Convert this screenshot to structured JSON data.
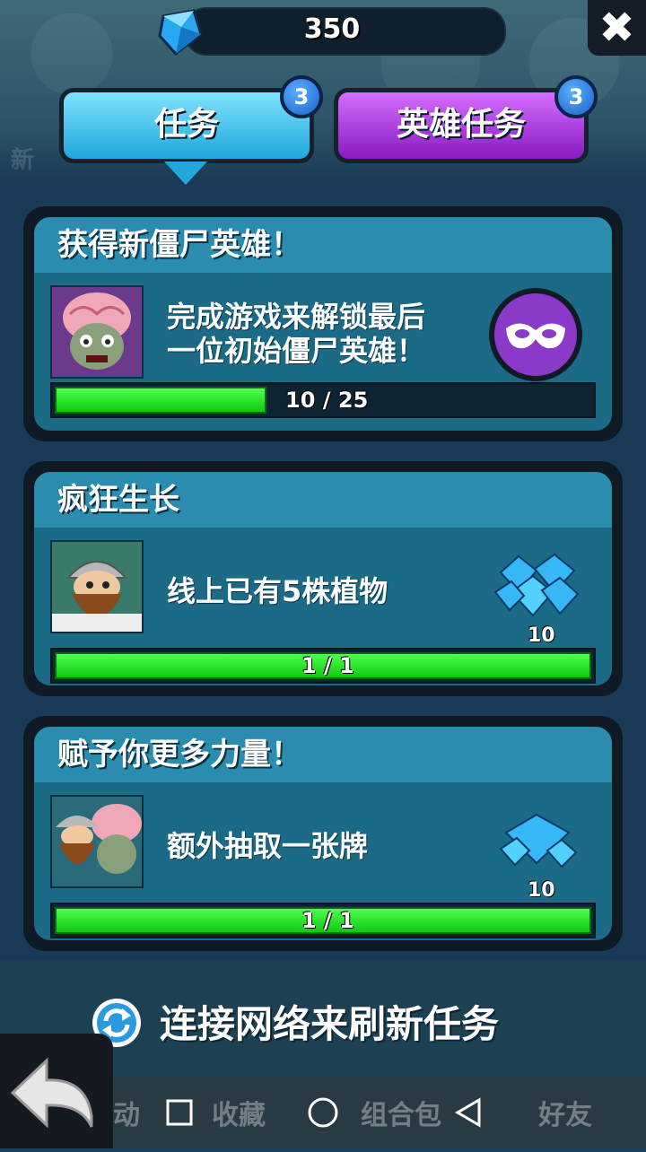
{
  "header": {
    "gem_count": "350",
    "close_label": "✖"
  },
  "tabs": [
    {
      "label": "任务",
      "badge": "3"
    },
    {
      "label": "英雄任务",
      "badge": "3"
    }
  ],
  "background": {
    "left_text": "新"
  },
  "quests": [
    {
      "title": "获得新僵尸英雄！",
      "description_line1": "完成游戏来解锁最后",
      "description_line2": "一位初始僵尸英雄！",
      "progress_text": "10 / 25",
      "progress_fraction": 0.4,
      "reward_icon": "mask-icon"
    },
    {
      "title": "疯狂生长",
      "description_line1": "线上已有5株植物",
      "progress_text": "1 / 1",
      "progress_fraction": 1.0,
      "reward_icon": "gem-pile-icon",
      "reward_amount": "10"
    },
    {
      "title": "赋予你更多力量！",
      "description_line1": "额外抽取一张牌",
      "progress_text": "1 / 1",
      "progress_fraction": 1.0,
      "reward_icon": "gem-pile-icon",
      "reward_amount": "10"
    }
  ],
  "footer": {
    "refresh_text": "连接网络来刷新任务",
    "nav_labels": [
      "动",
      "收藏",
      "组合包",
      "好友"
    ]
  },
  "colors": {
    "progress_green": "#22e022",
    "tab_tasks": "#1ea6da",
    "tab_hero": "#8a1ac0"
  }
}
